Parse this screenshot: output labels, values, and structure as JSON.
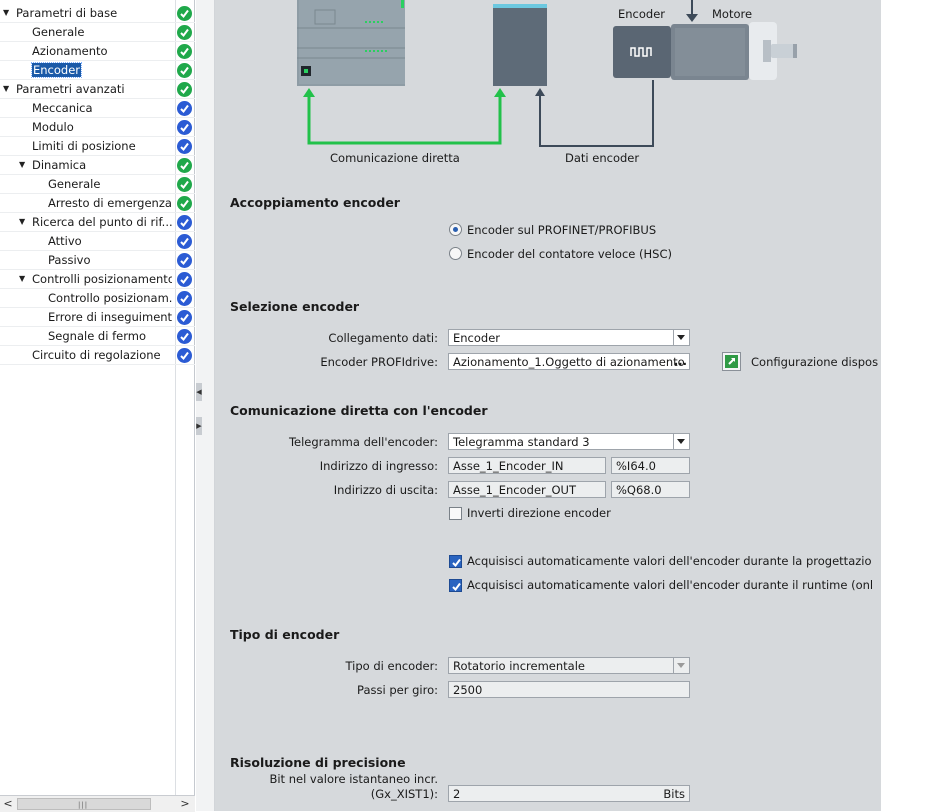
{
  "tree": {
    "items": [
      {
        "label": "Parametri di base",
        "level": 0,
        "toggle": "▼",
        "status": "ok"
      },
      {
        "label": "Generale",
        "level": 1,
        "toggle": "",
        "status": "ok"
      },
      {
        "label": "Azionamento",
        "level": 1,
        "toggle": "",
        "status": "ok"
      },
      {
        "label": "Encoder",
        "level": 1,
        "toggle": "",
        "status": "ok",
        "selected": true
      },
      {
        "label": "Parametri avanzati",
        "level": 0,
        "toggle": "▼",
        "status": "ok"
      },
      {
        "label": "Meccanica",
        "level": 1,
        "toggle": "",
        "status": "check"
      },
      {
        "label": "Modulo",
        "level": 1,
        "toggle": "",
        "status": "check"
      },
      {
        "label": "Limiti di posizione",
        "level": 1,
        "toggle": "",
        "status": "check"
      },
      {
        "label": "Dinamica",
        "level": 1,
        "toggle": "▼",
        "status": "ok"
      },
      {
        "label": "Generale",
        "level": 2,
        "toggle": "",
        "status": "ok"
      },
      {
        "label": "Arresto di emergenza",
        "level": 2,
        "toggle": "",
        "status": "ok"
      },
      {
        "label": "Ricerca del punto di rif...",
        "level": 1,
        "toggle": "▼",
        "status": "check"
      },
      {
        "label": "Attivo",
        "level": 2,
        "toggle": "",
        "status": "check"
      },
      {
        "label": "Passivo",
        "level": 2,
        "toggle": "",
        "status": "check"
      },
      {
        "label": "Controlli posizionamento",
        "level": 1,
        "toggle": "▼",
        "status": "check"
      },
      {
        "label": "Controllo posizionam...",
        "level": 2,
        "toggle": "",
        "status": "check"
      },
      {
        "label": "Errore di inseguimento",
        "level": 2,
        "toggle": "",
        "status": "check"
      },
      {
        "label": "Segnale di fermo",
        "level": 2,
        "toggle": "",
        "status": "check"
      },
      {
        "label": "Circuito di regolazione",
        "level": 1,
        "toggle": "",
        "status": "check"
      }
    ],
    "scroll_left": "<",
    "scroll_right": ">",
    "scroll_grip": "|||"
  },
  "splitter": {
    "up": "◀",
    "down": "▶"
  },
  "colors": {
    "ok": "#1fa84a",
    "check": "#2b5bd4",
    "selected": "#1b5aa8",
    "link_green": "#22c14a",
    "link_dark": "#3d4a59"
  },
  "diagram": {
    "encoder_label": "Encoder",
    "motor_label": "Motore",
    "direct_comm_label": "Comunicazione diretta",
    "encoder_data_label": "Dati encoder",
    "encoder_glyph": "⎍⎍"
  },
  "coupling": {
    "title": "Accoppiamento encoder",
    "option_profinet": "Encoder sul PROFINET/PROFIBUS",
    "option_hsc": "Encoder del contatore veloce (HSC)"
  },
  "selection": {
    "title": "Selezione encoder",
    "data_link_label": "Collegamento dati:",
    "data_link_value": "Encoder",
    "profidrive_label": "Encoder PROFIdrive:",
    "profidrive_value": "Azionamento_1.Oggetto di azionamento",
    "browse_label": "...",
    "config_label": "Configurazione dispos"
  },
  "direct": {
    "title": "Comunicazione diretta con l'encoder",
    "telegram_label": "Telegramma dell'encoder:",
    "telegram_value": "Telegramma standard 3",
    "input_label": "Indirizzo di ingresso:",
    "input_name": "Asse_1_Encoder_IN",
    "input_addr": "%I64.0",
    "output_label": "Indirizzo di uscita:",
    "output_name": "Asse_1_Encoder_OUT",
    "output_addr": "%Q68.0",
    "invert_label": "Inverti direzione encoder",
    "acq_design_label": "Acquisisci automaticamente valori dell'encoder durante la progettazio",
    "acq_runtime_label": "Acquisisci automaticamente valori dell'encoder durante il runtime (onl"
  },
  "type": {
    "title": "Tipo di encoder",
    "type_label": "Tipo di encoder:",
    "type_value": "Rotatorio incrementale",
    "steps_label": "Passi per giro:",
    "steps_value": "2500"
  },
  "precision": {
    "title": "Risoluzione di precisione",
    "bits_label_1": "Bit nel valore istantaneo incr.",
    "bits_label_2": "(Gx_XIST1):",
    "bits_value": "2",
    "bits_unit": "Bits"
  }
}
